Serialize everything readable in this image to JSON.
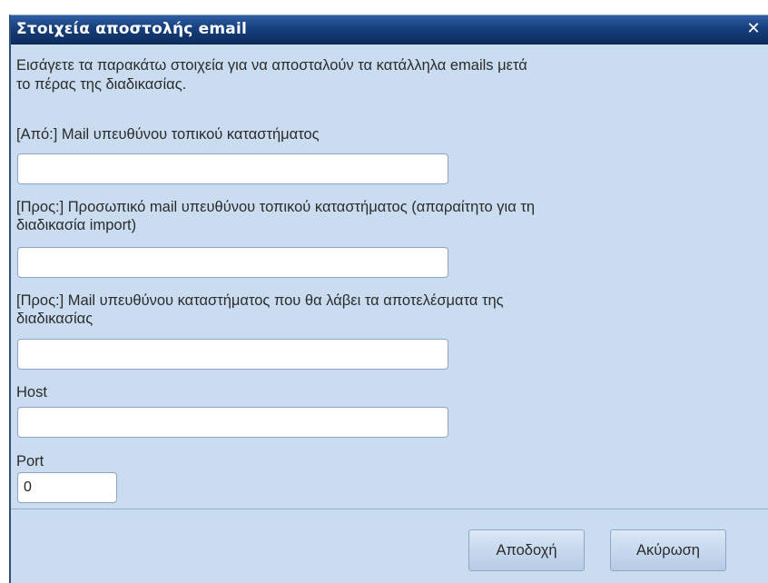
{
  "dialog": {
    "title": "Στοιχεία αποστολής email",
    "close_symbol": "✕",
    "close_icon": "close-icon",
    "intro_line1": "Εισάγετε τα παρακάτω στοιχεία για να αποσταλούν τα κατάλληλα emails μετά",
    "intro_line2": "το πέρας της διαδικασίας."
  },
  "fields": {
    "from_mail": {
      "label": "[Από:] Mail υπευθύνου τοπικού καταστήματος",
      "value": ""
    },
    "to_personal_mail": {
      "label_line1": "[Προς:] Προσωπικό mail υπευθύνου τοπικού καταστήματος (απαραίτητο για τη",
      "label_line2": "διαδικασία import)",
      "value": ""
    },
    "to_results_mail": {
      "label_line1": "[Προς:] Mail υπευθύνου καταστήματος που θα λάβει τα αποτελέσματα της",
      "label_line2": "διαδικασίας",
      "value": ""
    },
    "host": {
      "label": "Host",
      "value": ""
    },
    "port": {
      "label": "Port",
      "value": "0"
    }
  },
  "buttons": {
    "accept_label": "Αποδοχή",
    "cancel_label": "Ακύρωση"
  },
  "colors": {
    "titlebar": "#163f7c",
    "dialog_background": "#c9dcf0",
    "text": "#2b2b2b"
  }
}
